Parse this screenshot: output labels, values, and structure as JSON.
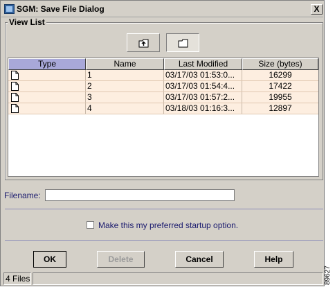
{
  "window": {
    "title": "SGM: Save File Dialog",
    "close_label": "X"
  },
  "view_list": {
    "label": "View List"
  },
  "toolbar": {
    "up_icon": "folder-up-icon",
    "folder_icon": "folder-icon"
  },
  "table": {
    "columns": [
      "Type",
      "Name",
      "Last Modified",
      "Size (bytes)"
    ],
    "rows": [
      {
        "type_icon": "file-icon",
        "name": "1",
        "modified": "03/17/03  01:53:0...",
        "size": "16299"
      },
      {
        "type_icon": "file-icon",
        "name": "2",
        "modified": "03/17/03  01:54:4...",
        "size": "17422"
      },
      {
        "type_icon": "file-icon",
        "name": "3",
        "modified": "03/17/03  01:57:2...",
        "size": "19955"
      },
      {
        "type_icon": "file-icon",
        "name": "4",
        "modified": "03/18/03  01:16:3...",
        "size": "12897"
      }
    ]
  },
  "filename": {
    "label": "Filename:",
    "value": ""
  },
  "startup_option": {
    "label": "Make this my preferred startup option.",
    "checked": false
  },
  "buttons": {
    "ok": "OK",
    "delete": "Delete",
    "cancel": "Cancel",
    "help": "Help"
  },
  "status": {
    "text": "4 Files"
  },
  "side_number": "89627"
}
